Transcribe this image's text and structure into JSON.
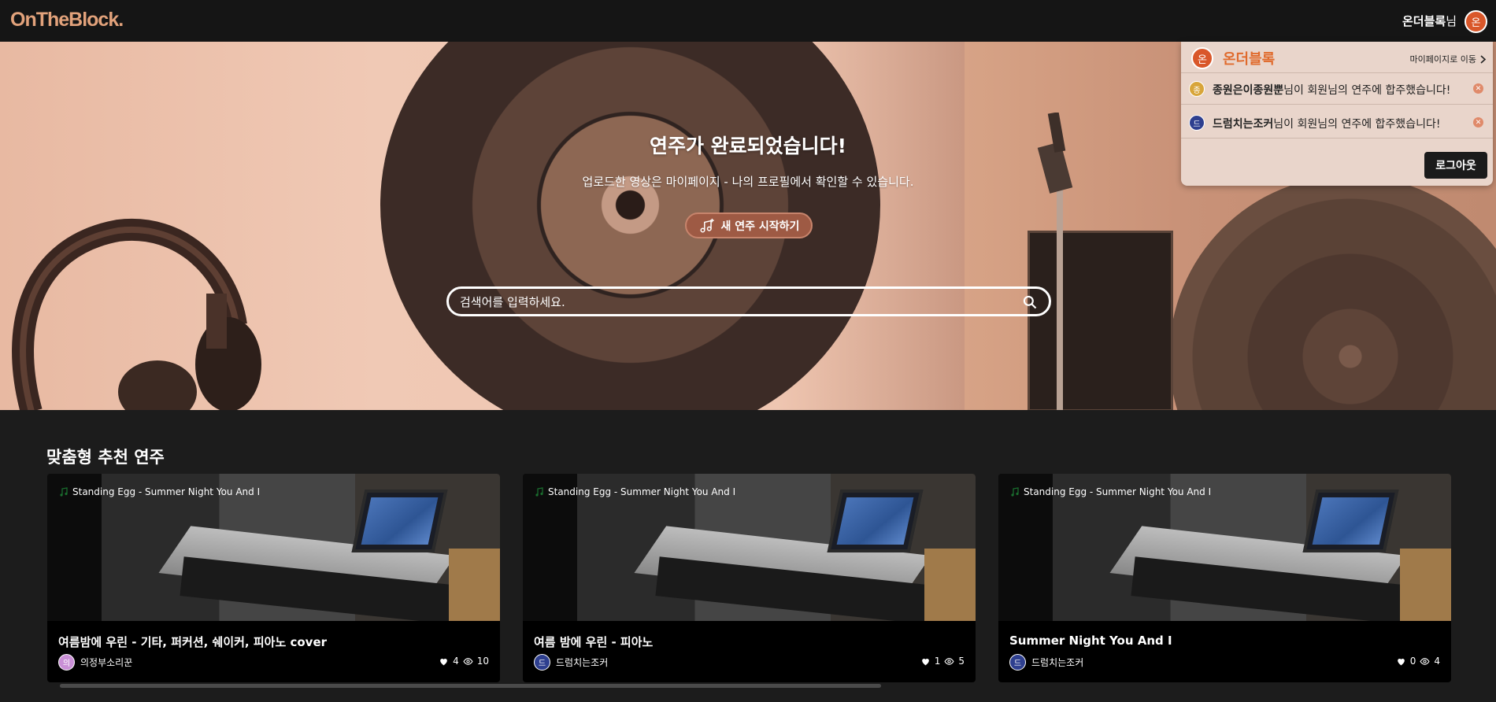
{
  "header": {
    "logo": "OnTheBlock.",
    "user_name": "온더블록",
    "user_suffix": "님",
    "avatar_initial": "온"
  },
  "hero": {
    "title": "연주가 완료되었습니다!",
    "subtitle": "업로드한 영상은 마이페이지 - 나의 프로필에서 확인할 수 있습니다.",
    "start_button": "새 연주 시작하기",
    "search_placeholder": "검색어를 입력하세요."
  },
  "notifications": {
    "avatar_initial": "온",
    "name": "온더블록",
    "mypage_link": "마이페이지로 이동",
    "items": [
      {
        "avatar_initial": "종",
        "avatar_color": "#d8a53a",
        "user": "종원은이종원뿐",
        "message": "님이 회원님의 연주에 합주했습니다!"
      },
      {
        "avatar_initial": "드",
        "avatar_color": "#2e3f8f",
        "user": "드럼치는조커",
        "message": "님이 회원님의 연주에 합주했습니다!"
      }
    ],
    "logout": "로그아웃"
  },
  "recommendations": {
    "title": "맞춤형 추천 연주",
    "cards": [
      {
        "track": "Standing Egg - Summer Night You And I",
        "title": "여름밤에 우린 - 기타, 퍼커션, 쉐이커, 피아노 cover",
        "author": "의정부소리꾼",
        "author_initial": "의",
        "author_color": "#c98fd6",
        "likes": "4",
        "views": "10"
      },
      {
        "track": "Standing Egg - Summer Night You And I",
        "title": "여름 밤에 우린 - 피아노",
        "author": "드럼치는조커",
        "author_initial": "드",
        "author_color": "#2e3f8f",
        "likes": "1",
        "views": "5"
      },
      {
        "track": "Standing Egg - Summer Night You And I",
        "title": "Summer Night You And I",
        "author": "드럼치는조커",
        "author_initial": "드",
        "author_color": "#2e3f8f",
        "likes": "0",
        "views": "4"
      }
    ]
  },
  "colors": {
    "accent": "#e06a2c",
    "logo": "#e2a27b",
    "button": "#9e5a44"
  }
}
